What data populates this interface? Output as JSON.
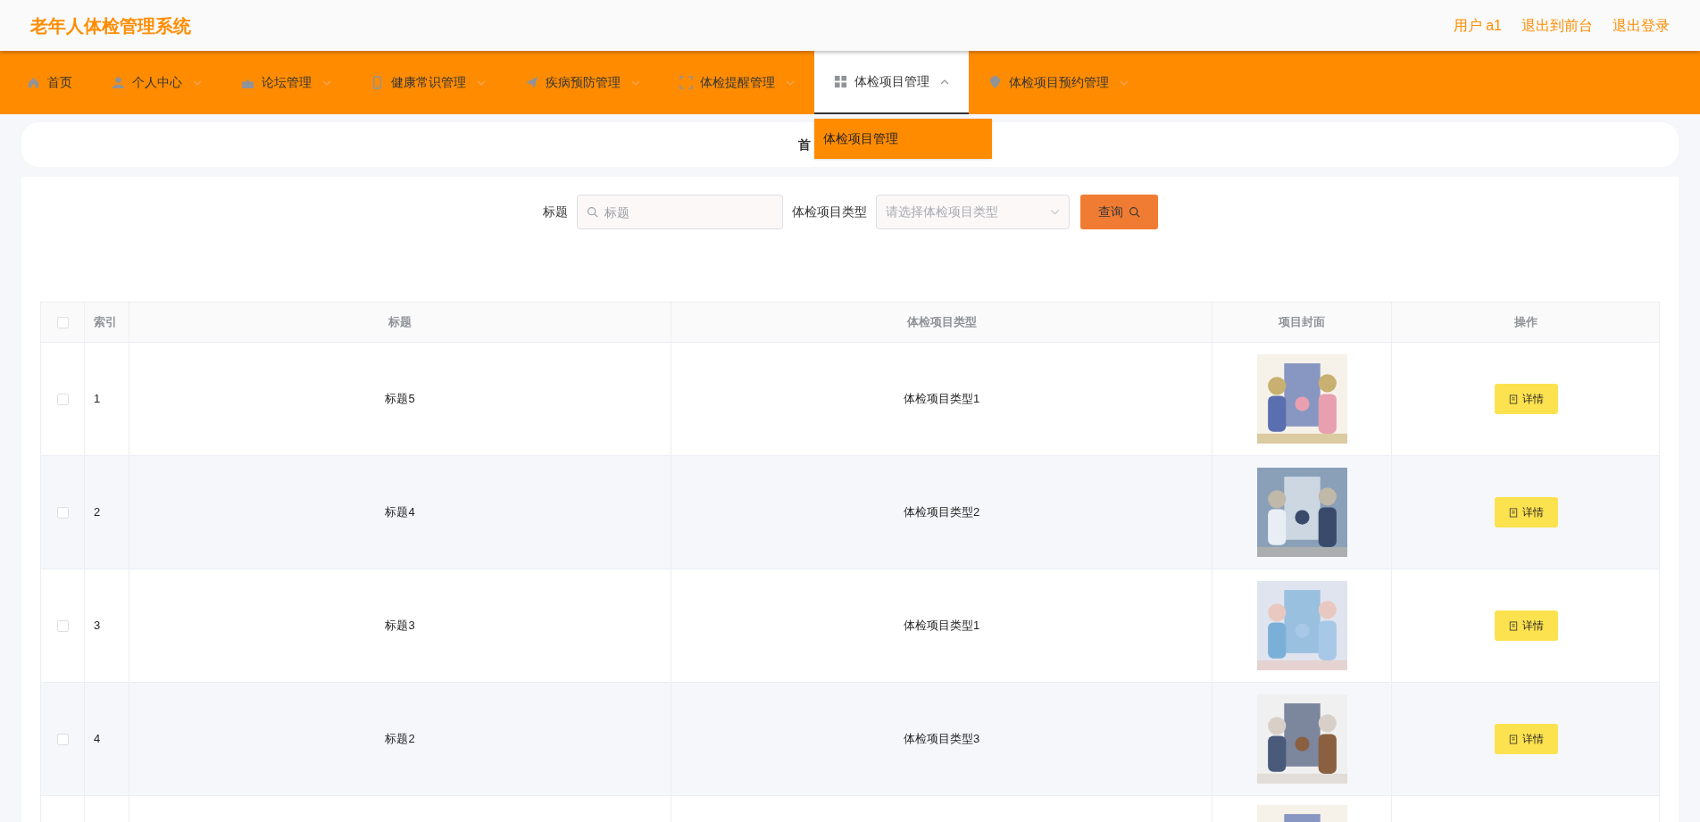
{
  "header": {
    "title": "老年人体检管理系统",
    "links": [
      "用户 a1",
      "退出到前台",
      "退出登录"
    ]
  },
  "nav": [
    {
      "label": "首页",
      "kind": "link",
      "selected": false
    },
    {
      "label": "个人中心",
      "kind": "submenu",
      "selected": false,
      "expanded": false
    },
    {
      "label": "论坛管理",
      "kind": "submenu",
      "selected": false,
      "expanded": false
    },
    {
      "label": "健康常识管理",
      "kind": "submenu",
      "selected": false,
      "expanded": false
    },
    {
      "label": "疾病预防管理",
      "kind": "submenu",
      "selected": false,
      "expanded": false
    },
    {
      "label": "体检提醒管理",
      "kind": "submenu",
      "selected": false,
      "expanded": false
    },
    {
      "label": "体检项目管理",
      "kind": "submenu",
      "selected": true,
      "expanded": true,
      "submenu": [
        "体检项目管理"
      ]
    },
    {
      "label": "体检项目预约管理",
      "kind": "submenu",
      "selected": false,
      "expanded": false
    }
  ],
  "breadcrumb": "首",
  "search": {
    "fields": [
      {
        "label": "标题",
        "kind": "input",
        "placeholder": "标题"
      },
      {
        "label": "体检项目类型",
        "kind": "select",
        "placeholder": "请选择体检项目类型"
      }
    ],
    "button": "查询"
  },
  "table": {
    "columns": [
      "索引",
      "标题",
      "体检项目类型",
      "项目封面",
      "操作"
    ],
    "all_checked": false,
    "rows": [
      {
        "checked": false,
        "index": "1",
        "title": "标题5",
        "type": "体检项目类型1",
        "cover": {
          "kind": "picture"
        },
        "action": "详情"
      },
      {
        "checked": false,
        "index": "2",
        "title": "标题4",
        "type": "体检项目类型2",
        "cover": {
          "kind": "picture"
        },
        "action": "详情"
      },
      {
        "checked": false,
        "index": "3",
        "title": "标题3",
        "type": "体检项目类型1",
        "cover": {
          "kind": "picture"
        },
        "action": "详情"
      },
      {
        "checked": false,
        "index": "4",
        "title": "标题2",
        "type": "体检项目类型3",
        "cover": {
          "kind": "picture"
        },
        "action": "详情"
      },
      {
        "cover": {
          "kind": "picture"
        }
      }
    ]
  }
}
